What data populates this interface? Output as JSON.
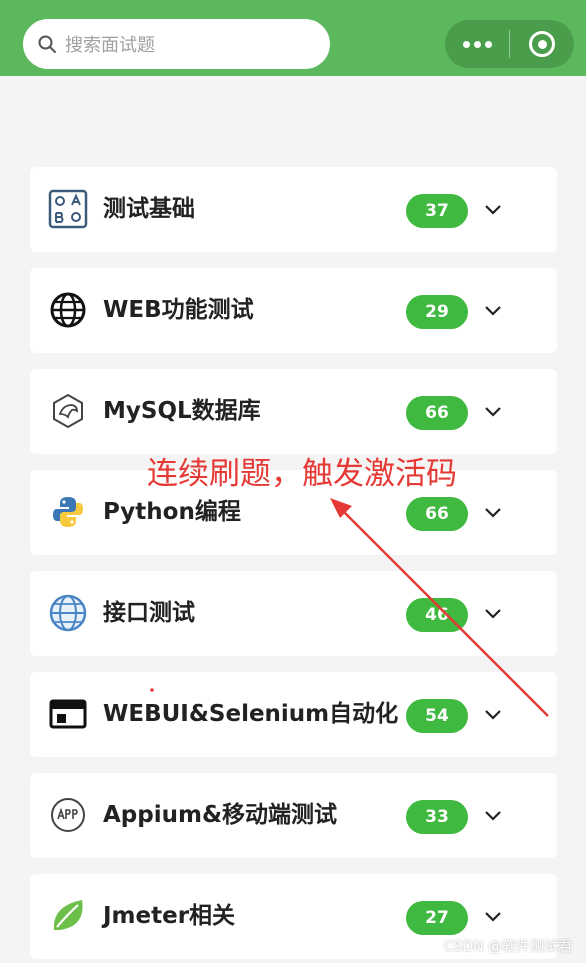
{
  "search": {
    "placeholder": "搜索面试题",
    "icon": "search-icon"
  },
  "capsule": {
    "menu_icon": "more-dots-icon",
    "close_icon": "target-icon"
  },
  "colors": {
    "header": "#5cb85c",
    "badge": "#3fb93f",
    "annotation": "#e53935"
  },
  "categories": [
    {
      "label": "测试基础",
      "count": "37",
      "icon": "abc-board-icon"
    },
    {
      "label": "WEB功能测试",
      "count": "29",
      "icon": "globe-icon"
    },
    {
      "label": "MySQL数据库",
      "count": "66",
      "icon": "mysql-dolphin-icon"
    },
    {
      "label": "Python编程",
      "count": "66",
      "icon": "python-icon"
    },
    {
      "label": "接口测试",
      "count": "46",
      "icon": "network-globe-icon"
    },
    {
      "label": "WEBUI&Selenium自动化",
      "count": "54",
      "icon": "browser-window-icon"
    },
    {
      "label": "Appium&移动端测试",
      "count": "33",
      "icon": "app-icon"
    },
    {
      "label": "Jmeter相关",
      "count": "27",
      "icon": "leaf-icon"
    }
  ],
  "annotation": {
    "text": "连续刷题，触发激活码"
  },
  "watermark": {
    "text": "CSDN @软件测试君"
  }
}
